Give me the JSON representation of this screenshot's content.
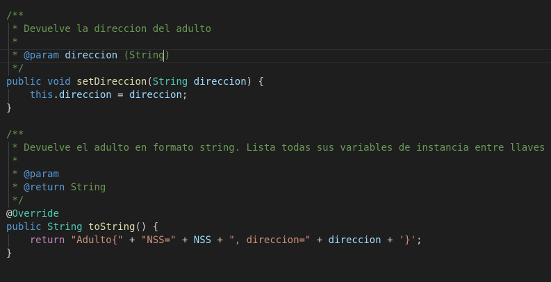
{
  "editor": {
    "colors": {
      "background": "#1e1e1e",
      "comment": "#6a9955",
      "keyword": "#569cd6",
      "type": "#4ec9b0",
      "function": "#dcdcaa",
      "variable": "#9cdcfe",
      "string": "#ce9178",
      "control": "#c586c0",
      "text": "#d4d4d4"
    },
    "lines": [
      [
        {
          "t": "/**",
          "c": "comment"
        }
      ],
      [
        {
          "t": " * Devuelve la direccion del adulto",
          "c": "comment"
        }
      ],
      [
        {
          "t": " *",
          "c": "comment"
        }
      ],
      [
        {
          "t": " * ",
          "c": "comment"
        },
        {
          "t": "@param",
          "c": "kw"
        },
        {
          "t": " ",
          "c": "comment"
        },
        {
          "t": "direccion",
          "c": "var"
        },
        {
          "t": " (String)",
          "c": "comment"
        }
      ],
      [
        {
          "t": " */",
          "c": "comment"
        }
      ],
      [
        {
          "t": "public",
          "c": "kw"
        },
        {
          "t": " ",
          "c": "plain"
        },
        {
          "t": "void",
          "c": "kw"
        },
        {
          "t": " ",
          "c": "plain"
        },
        {
          "t": "setDireccion",
          "c": "fn"
        },
        {
          "t": "(",
          "c": "plain"
        },
        {
          "t": "String",
          "c": "type"
        },
        {
          "t": " ",
          "c": "plain"
        },
        {
          "t": "direccion",
          "c": "var"
        },
        {
          "t": ") {",
          "c": "plain"
        }
      ],
      [
        {
          "t": "    ",
          "c": "plain"
        },
        {
          "t": "this",
          "c": "kw"
        },
        {
          "t": ".",
          "c": "plain"
        },
        {
          "t": "direccion",
          "c": "var"
        },
        {
          "t": " = ",
          "c": "plain"
        },
        {
          "t": "direccion",
          "c": "var"
        },
        {
          "t": ";",
          "c": "plain"
        }
      ],
      [
        {
          "t": "}",
          "c": "plain"
        }
      ],
      [],
      [
        {
          "t": "/**",
          "c": "comment"
        }
      ],
      [
        {
          "t": " * Devuelve el adulto en formato string. Lista todas sus variables de instancia entre llaves",
          "c": "comment"
        }
      ],
      [
        {
          "t": " *",
          "c": "comment"
        }
      ],
      [
        {
          "t": " * ",
          "c": "comment"
        },
        {
          "t": "@param",
          "c": "kw"
        }
      ],
      [
        {
          "t": " * ",
          "c": "comment"
        },
        {
          "t": "@return",
          "c": "kw"
        },
        {
          "t": " String",
          "c": "comment"
        }
      ],
      [
        {
          "t": " */",
          "c": "comment"
        }
      ],
      [
        {
          "t": "@",
          "c": "plain"
        },
        {
          "t": "Override",
          "c": "type"
        }
      ],
      [
        {
          "t": "public",
          "c": "kw"
        },
        {
          "t": " ",
          "c": "plain"
        },
        {
          "t": "String",
          "c": "type"
        },
        {
          "t": " ",
          "c": "plain"
        },
        {
          "t": "toString",
          "c": "fn"
        },
        {
          "t": "() {",
          "c": "plain"
        }
      ],
      [
        {
          "t": "    ",
          "c": "plain"
        },
        {
          "t": "return",
          "c": "ctl"
        },
        {
          "t": " ",
          "c": "plain"
        },
        {
          "t": "\"Adulto{\"",
          "c": "str"
        },
        {
          "t": " + ",
          "c": "plain"
        },
        {
          "t": "\"NSS=\"",
          "c": "str"
        },
        {
          "t": " + ",
          "c": "plain"
        },
        {
          "t": "NSS",
          "c": "var"
        },
        {
          "t": " + ",
          "c": "plain"
        },
        {
          "t": "\", direccion=\"",
          "c": "str"
        },
        {
          "t": " + ",
          "c": "plain"
        },
        {
          "t": "direccion",
          "c": "var"
        },
        {
          "t": " + ",
          "c": "plain"
        },
        {
          "t": "'}'",
          "c": "str"
        },
        {
          "t": ";",
          "c": "plain"
        }
      ],
      [
        {
          "t": "}",
          "c": "plain"
        }
      ]
    ]
  }
}
